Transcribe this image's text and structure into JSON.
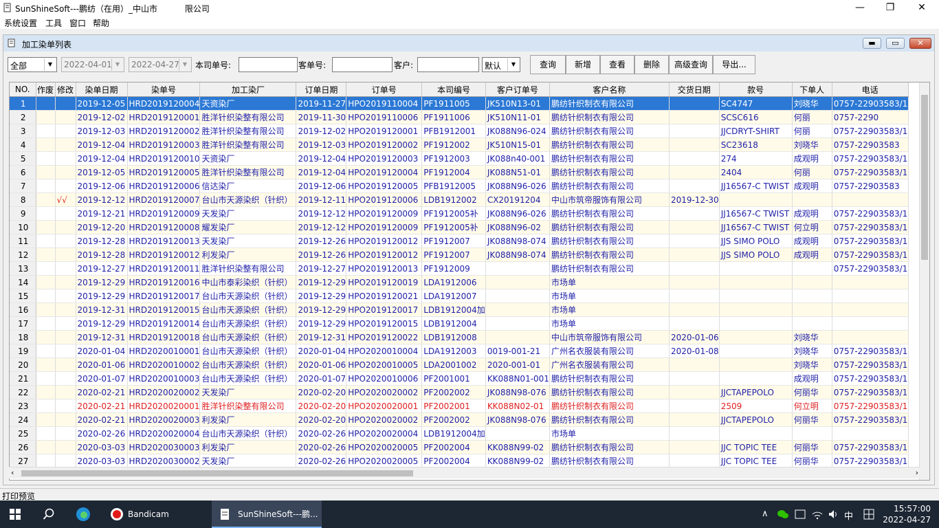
{
  "window": {
    "title": "SunShineSoft---鹏纺（在用）_中山市　　　 限公司",
    "min": "—",
    "restore": "❐",
    "close": "✕"
  },
  "menu": [
    "系统设置",
    "工具",
    "窗口",
    "帮助"
  ],
  "child": {
    "title": "加工染单列表",
    "min": "▬",
    "max": "▭",
    "close": "✕"
  },
  "filter": {
    "scope": "全部",
    "date_from": "2022-04-01",
    "date_to": "2022-04-27",
    "company_no_label": "本司单号:",
    "company_no_value": "",
    "customer_no_label": "客单号:",
    "customer_no_value": "",
    "customer_label": "客户:",
    "customer_value": "",
    "sort": "默认"
  },
  "buttons": [
    "查询",
    "新增",
    "查看",
    "删除",
    "高级查询",
    "导出..."
  ],
  "table": {
    "columns": [
      "NO.",
      "作废",
      "修改",
      "染单日期",
      "染单号",
      "加工染厂",
      "订单日期",
      "订单号",
      "本司编号",
      "客户订单号",
      "客户名称",
      "交货日期",
      "款号",
      "下单人",
      "电话"
    ],
    "rows": [
      [
        "1",
        "",
        "",
        "2019-12-05",
        "HRD2019120004",
        "天资染厂",
        "2019-11-27",
        "HPO2019110004",
        "PF1911005",
        "JK510N13-01",
        "鹏纺针织制衣有限公司",
        "",
        "SC4747",
        "刘晓华",
        "0757-22903583/1"
      ],
      [
        "2",
        "",
        "",
        "2019-12-02",
        "HRD2019120001",
        "胜洋针织染整有限公司",
        "2019-11-30",
        "HPO2019110006",
        "PF1911006",
        "JK510N11-01",
        "鹏纺针织制衣有限公司",
        "",
        "SCSC616",
        "何丽",
        "0757-2290"
      ],
      [
        "3",
        "",
        "",
        "2019-12-03",
        "HRD2019120002",
        "胜洋针织染整有限公司",
        "2019-12-02",
        "HPO2019120001",
        "PFB1912001",
        "JK088N96-024",
        "鹏纺针织制衣有限公司",
        "",
        "JJCDRYT-SHIRT",
        "何丽",
        "0757-22903583/1"
      ],
      [
        "4",
        "",
        "",
        "2019-12-04",
        "HRD2019120003",
        "胜洋针织染整有限公司",
        "2019-12-03",
        "HPO2019120002",
        "PF1912002",
        "JK510N15-01",
        "鹏纺针织制衣有限公司",
        "",
        "SC23618",
        "刘晓华",
        "0757-22903583"
      ],
      [
        "5",
        "",
        "",
        "2019-12-04",
        "HRD2019120010",
        "天资染厂",
        "2019-12-04",
        "HPO2019120003",
        "PF1912003",
        "JK088n40-001",
        "鹏纺针织制衣有限公司",
        "",
        "274",
        "成观明",
        "0757-22903583/1"
      ],
      [
        "6",
        "",
        "",
        "2019-12-05",
        "HRD2019120005",
        "胜洋针织染整有限公司",
        "2019-12-04",
        "HPO2019120004",
        "PF1912004",
        "JK088N51-01",
        "鹏纺针织制衣有限公司",
        "",
        "2404",
        "何丽",
        "0757-22903583/1"
      ],
      [
        "7",
        "",
        "",
        "2019-12-06",
        "HRD2019120006",
        "信达染厂",
        "2019-12-06",
        "HPO2019120005",
        "PFB1912005",
        "JK088N96-026",
        "鹏纺针织制衣有限公司",
        "",
        "JJ16567-C TWIST",
        "成观明",
        "0757-22903583"
      ],
      [
        "8",
        "",
        "√√",
        "2019-12-12",
        "HRD2019120007",
        "台山市天源染织（针织）",
        "2019-12-11",
        "HPO2019120006",
        "LDB1912002",
        "CX20191204",
        "中山市筑帝服饰有限公司",
        "2019-12-30",
        "",
        "",
        ""
      ],
      [
        "9",
        "",
        "",
        "2019-12-21",
        "HRD2019120009",
        "天发染厂",
        "2019-12-12",
        "HPO2019120009",
        "PF1912005补",
        "JK088N96-026",
        "鹏纺针织制衣有限公司",
        "",
        "JJ16567-C TWIST",
        "成观明",
        "0757-22903583/1"
      ],
      [
        "10",
        "",
        "",
        "2019-12-20",
        "HRD2019120008",
        "耀发染厂",
        "2019-12-12",
        "HPO2019120009",
        "PF1912005补",
        "JK088N96-02",
        "鹏纺针织制衣有限公司",
        "",
        "JJ16567-C TWIST",
        "何立明",
        "0757-22903583/1"
      ],
      [
        "11",
        "",
        "",
        "2019-12-28",
        "HRD2019120013",
        "天发染厂",
        "2019-12-26",
        "HPO2019120012",
        "PF1912007",
        "JK088N98-074",
        "鹏纺针织制衣有限公司",
        "",
        "JJS SIMO POLO",
        "成观明",
        "0757-22903583/1"
      ],
      [
        "12",
        "",
        "",
        "2019-12-28",
        "HRD2019120012",
        "利发染厂",
        "2019-12-26",
        "HPO2019120012",
        "PF1912007",
        "JK088N98-074",
        "鹏纺针织制衣有限公司",
        "",
        "JJS SIMO POLO",
        "成观明",
        "0757-22903583/1"
      ],
      [
        "13",
        "",
        "",
        "2019-12-27",
        "HRD2019120011",
        "胜洋针织染整有限公司",
        "2019-12-27",
        "HPO2019120013",
        "PF1912009",
        "",
        "鹏纺针织制衣有限公司",
        "",
        "",
        "",
        "0757-22903583/1"
      ],
      [
        "14",
        "",
        "",
        "2019-12-29",
        "HRD2019120016",
        "中山市泰彩染织（针织）",
        "2019-12-29",
        "HPO2019120019",
        "LDA1912006",
        "",
        "市场单",
        "",
        "",
        "",
        ""
      ],
      [
        "15",
        "",
        "",
        "2019-12-29",
        "HRD2019120017",
        "台山市天源染织（针织）",
        "2019-12-29",
        "HPO2019120021",
        "LDA1912007",
        "",
        "市场单",
        "",
        "",
        "",
        ""
      ],
      [
        "16",
        "",
        "",
        "2019-12-31",
        "HRD2019120015",
        "台山市天源染织（针织）",
        "2019-12-29",
        "HPO2019120017",
        "LDB1912004加",
        "",
        "市场单",
        "",
        "",
        "",
        ""
      ],
      [
        "17",
        "",
        "",
        "2019-12-29",
        "HRD2019120014",
        "台山市天源染织（针织）",
        "2019-12-29",
        "HPO2019120015",
        "LDB1912004",
        "",
        "市场单",
        "",
        "",
        "",
        ""
      ],
      [
        "18",
        "",
        "",
        "2019-12-31",
        "HRD2019120018",
        "台山市天源染织（针织）",
        "2019-12-31",
        "HPO2019120022",
        "LDB1912008",
        "",
        "中山市筑帝服饰有限公司",
        "2020-01-06",
        "",
        "刘晓华",
        ""
      ],
      [
        "19",
        "",
        "",
        "2020-01-04",
        "HRD2020010001",
        "台山市天源染织（针织）",
        "2020-01-04",
        "HPO2020010004",
        "LDA1912003",
        "0019-001-21",
        "广州名衣服装有限公司",
        "2020-01-08",
        "",
        "刘晓华",
        "0757-22903583/1"
      ],
      [
        "20",
        "",
        "",
        "2020-01-06",
        "HRD2020010002",
        "台山市天源染织（针织）",
        "2020-01-06",
        "HPO2020010005",
        "LDA2001002",
        "2020-001-01",
        "广州名衣服装有限公司",
        "",
        "",
        "刘晓华",
        "0757-22903583/1"
      ],
      [
        "21",
        "",
        "",
        "2020-01-07",
        "HRD2020010003",
        "台山市天源染织（针织）",
        "2020-01-07",
        "HPO2020010006",
        "PF2001001",
        "KK088N01-001",
        "鹏纺针织制衣有限公司",
        "",
        "",
        "成观明",
        "0757-22903583/1"
      ],
      [
        "22",
        "",
        "",
        "2020-02-21",
        "HRD2020020002",
        "天发染厂",
        "2020-02-20",
        "HPO2020020002",
        "PF2002002",
        "JK088N98-076",
        "鹏纺针织制衣有限公司",
        "",
        "JJCTAPEPOLO",
        "何丽华",
        "0757-22903583/1"
      ],
      [
        "23",
        "",
        "",
        "2020-02-21",
        "HRD2020020001",
        "胜洋针织染整有限公司",
        "2020-02-20",
        "HPO2020020001",
        "PF2002001",
        "KK088N02-01",
        "鹏纺针织制衣有限公司",
        "",
        "2509",
        "何立明",
        "0757-22903583/1"
      ],
      [
        "24",
        "",
        "",
        "2020-02-21",
        "HRD2020020003",
        "利发染厂",
        "2020-02-20",
        "HPO2020020002",
        "PF2002002",
        "JK088N98-076",
        "鹏纺针织制衣有限公司",
        "",
        "JJCTAPEPOLO",
        "何丽华",
        "0757-22903583/1"
      ],
      [
        "25",
        "",
        "",
        "2020-02-26",
        "HRD2020020004",
        "台山市天源染织（针织）",
        "2020-02-26",
        "HPO2020020004",
        "LDB1912004加",
        "",
        "市场单",
        "",
        "",
        "",
        ""
      ],
      [
        "26",
        "",
        "",
        "2020-03-03",
        "HRD2020030003",
        "利发染厂",
        "2020-02-26",
        "HPO2020020005",
        "PF2002004",
        "KK088N99-02",
        "鹏纺针织制衣有限公司",
        "",
        "JJC TOPIC TEE",
        "何丽华",
        "0757-22903583/1"
      ],
      [
        "27",
        "",
        "",
        "2020-03-03",
        "HRD2020030002",
        "天发染厂",
        "2020-02-26",
        "HPO2020020005",
        "PF2002004",
        "KK088N99-02",
        "鹏纺针织制衣有限公司",
        "",
        "JJC TOPIC TEE",
        "何丽华",
        "0757-22903583/1"
      ]
    ]
  },
  "status": "打印预览",
  "taskbar": {
    "apps": [
      "Bandicam",
      "SunShineSoft---鹏..."
    ],
    "tray": [
      "∧",
      "中"
    ],
    "time": "15:57:00",
    "date": "2022-04-27"
  },
  "colors": {
    "selected_row": "#2b78d5",
    "row_text": "#1f1fa8",
    "red_row": "#e02020",
    "alt_row": "#fffbe8"
  }
}
